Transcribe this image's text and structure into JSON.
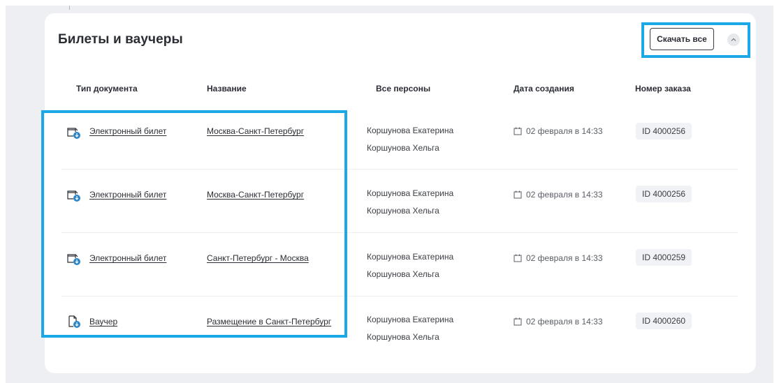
{
  "title": "Билеты и ваучеры",
  "actions": {
    "download_all": "Скачать все"
  },
  "columns": {
    "doc_type": "Тип документа",
    "name": "Название",
    "persons": "Все персоны",
    "created": "Дата создания",
    "order": "Номер заказа"
  },
  "rows": [
    {
      "doc_type": "Электронный билет",
      "doc_icon": "ticket-download-icon",
      "name": "Москва-Санкт-Петербург",
      "persons": [
        "Коршунова Екатерина",
        "Коршунова Хельга"
      ],
      "created": "02 февраля в 14:33",
      "order": "ID 4000256"
    },
    {
      "doc_type": "Электронный билет",
      "doc_icon": "ticket-download-icon",
      "name": "Москва-Санкт-Петербург",
      "persons": [
        "Коршунова Екатерина",
        "Коршунова Хельга"
      ],
      "created": "02 февраля в 14:33",
      "order": "ID 4000256"
    },
    {
      "doc_type": "Электронный билет",
      "doc_icon": "ticket-download-icon",
      "name": "Санкт-Петербург - Москва",
      "persons": [
        "Коршунова Екатерина",
        "Коршунова Хельга"
      ],
      "created": "02 февраля в 14:33",
      "order": "ID 4000259"
    },
    {
      "doc_type": "Ваучер",
      "doc_icon": "voucher-download-icon",
      "name": "Размещение в Санкт-Петербург",
      "persons": [
        "Коршунова Екатерина",
        "Коршунова Хельга"
      ],
      "created": "02 февраля в 14:33",
      "order": "ID 4000260"
    }
  ],
  "colors": {
    "highlight": "#1aa9e6",
    "icon_accent": "#2a86c9",
    "text": "#2a2d33"
  }
}
